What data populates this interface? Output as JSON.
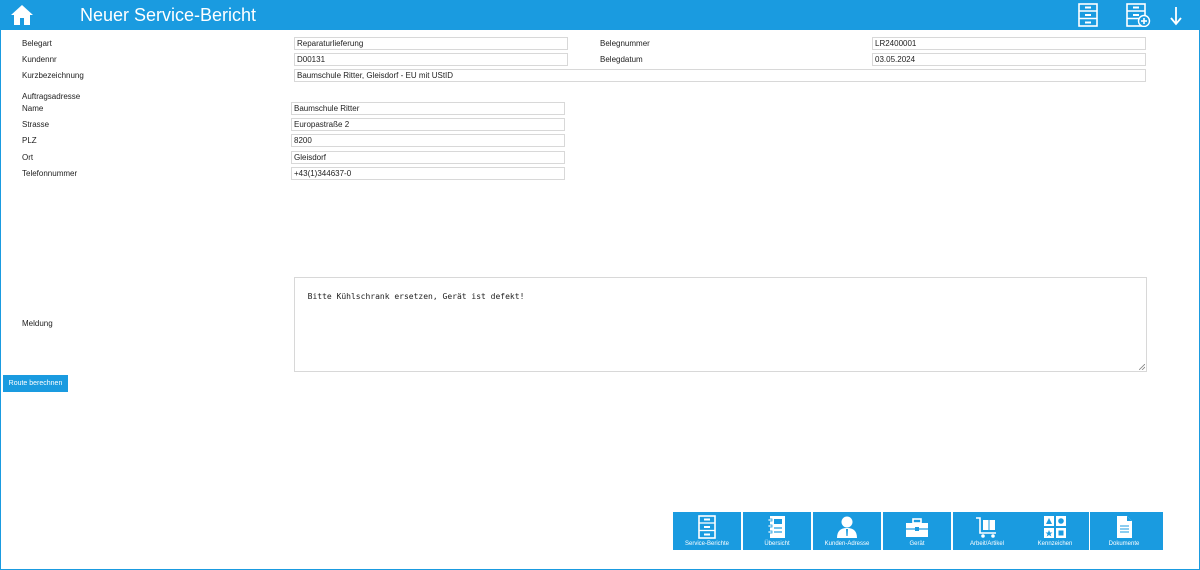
{
  "header": {
    "title": "Neuer Service-Bericht",
    "icons": [
      "home-icon",
      "cabinet-list-icon",
      "cabinet-add-icon",
      "arrow-down-icon"
    ]
  },
  "form": {
    "belegart": {
      "label": "Belegart",
      "value": "Reparaturlieferung"
    },
    "belegnummer": {
      "label": "Belegnummer",
      "value": "LR2400001"
    },
    "kundennr": {
      "label": "Kundennr",
      "value": "D00131"
    },
    "belegdatum": {
      "label": "Belegdatum",
      "value": "03.05.2024"
    },
    "kurzbezeichnung": {
      "label": "Kurzbezeichnung",
      "value": "Baumschule Ritter, Gleisdorf - EU mit UStID"
    },
    "auftragsadresse_label": "Auftragsadresse",
    "name": {
      "label": "Name",
      "value": "Baumschule Ritter"
    },
    "strasse": {
      "label": "Strasse",
      "value": "Europastraße 2"
    },
    "plz": {
      "label": "PLZ",
      "value": "8200"
    },
    "ort": {
      "label": "Ort",
      "value": "Gleisdorf"
    },
    "telefonnummer": {
      "label": "Telefonnummer",
      "value": "+43(1)344637-0"
    },
    "meldung": {
      "label": "Meldung",
      "value": "Bitte Kühlschrank ersetzen, Gerät ist defekt!"
    }
  },
  "route_button": "Route berechnen",
  "toolbar": {
    "items": [
      {
        "label": "Service-Berichte",
        "icon": "cabinet-icon"
      },
      {
        "label": "Übersicht",
        "icon": "notebook-icon"
      },
      {
        "label": "Kunden-Adresse",
        "icon": "person-icon"
      },
      {
        "label": "Gerät",
        "icon": "toolbox-icon"
      },
      {
        "label": "Arbeit/Artikel",
        "icon": "cart-icon"
      },
      {
        "label": "Kennzeichen",
        "icon": "shapes-icon"
      },
      {
        "label": "Dokumente",
        "icon": "document-icon"
      }
    ]
  },
  "colors": {
    "accent": "#1a9be0",
    "text": "#222222",
    "border": "#d8d8d8"
  }
}
